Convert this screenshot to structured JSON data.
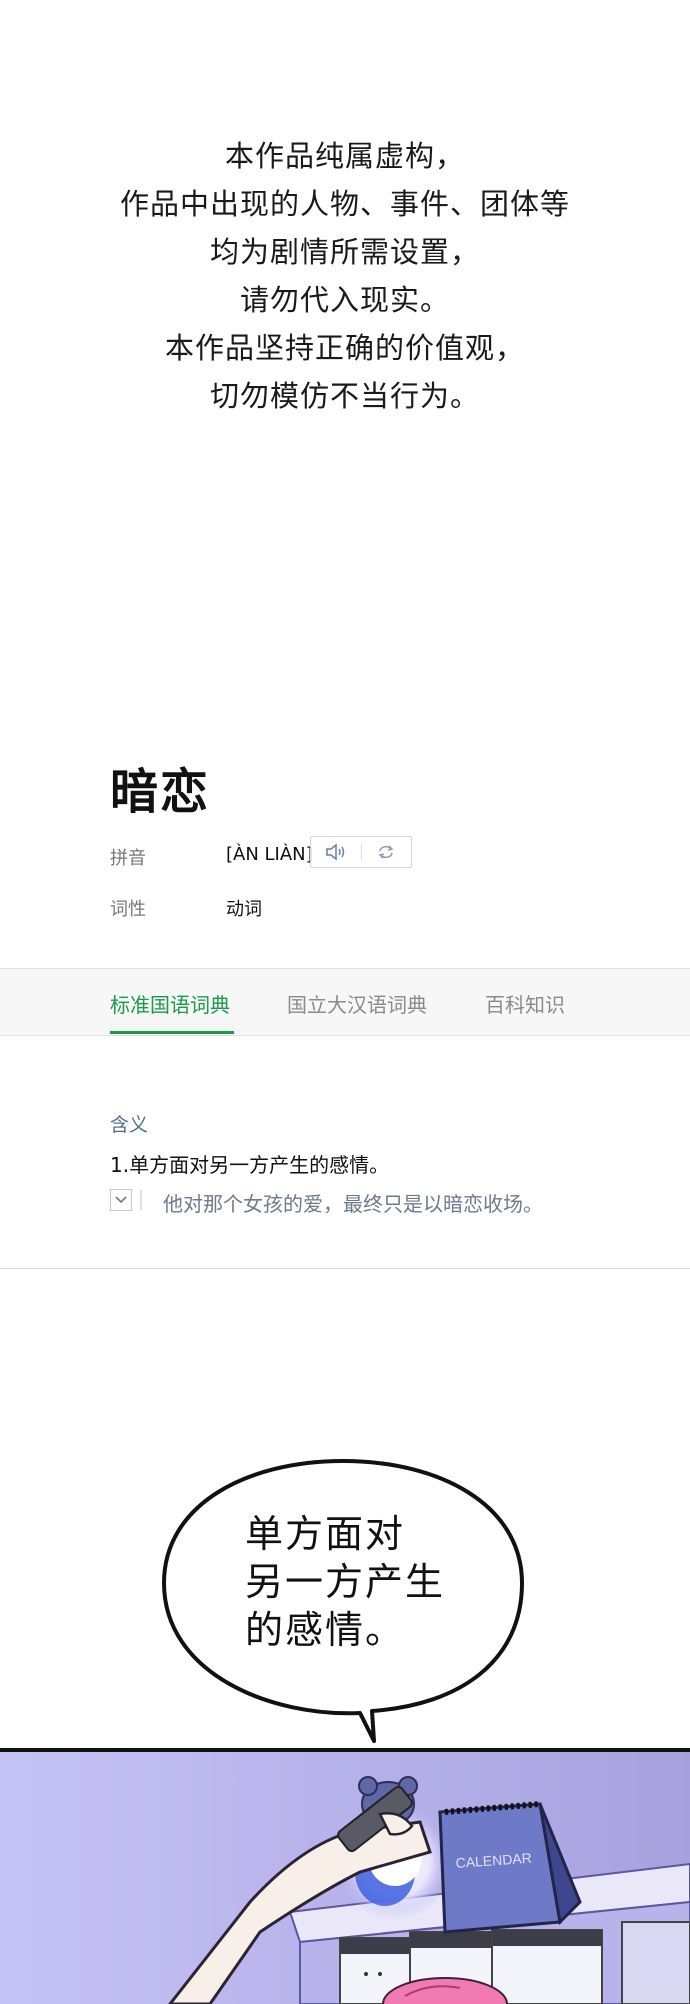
{
  "disclaimer": {
    "lines": [
      "本作品纯属虚构，",
      "作品中出现的人物、事件、团体等",
      "均为剧情所需设置，",
      "请勿代入现实。",
      "本作品坚持正确的价值观，",
      "切勿模仿不当行为。"
    ]
  },
  "dictionary": {
    "headword": "暗恋",
    "pinyin_label": "拼音",
    "pinyin_value": "[ÀN LIÀN]",
    "pos_label": "词性",
    "pos_value": "动词",
    "icons": [
      "speaker-icon",
      "replay-icon",
      "chevron-down-icon"
    ]
  },
  "tabs": [
    "标准国语词典",
    "国立大汉语词典",
    "百科知识"
  ],
  "active_tab": "标准国语词典",
  "meaning": {
    "title": "含义",
    "definition": "1.单方面对另一方产生的感情。",
    "example": "他对那个女孩的爱，最终只是以暗恋收场。"
  },
  "speech_bubble": {
    "lines": [
      "单方面对",
      "另一方产生",
      "的感情。"
    ]
  },
  "comic_panel": {
    "calendar_text": "CALENDAR"
  },
  "colors": {
    "accent_green": "#1b9a4a",
    "meaning_title": "#4f6e8f",
    "panel_background": "#c9c6f2"
  }
}
